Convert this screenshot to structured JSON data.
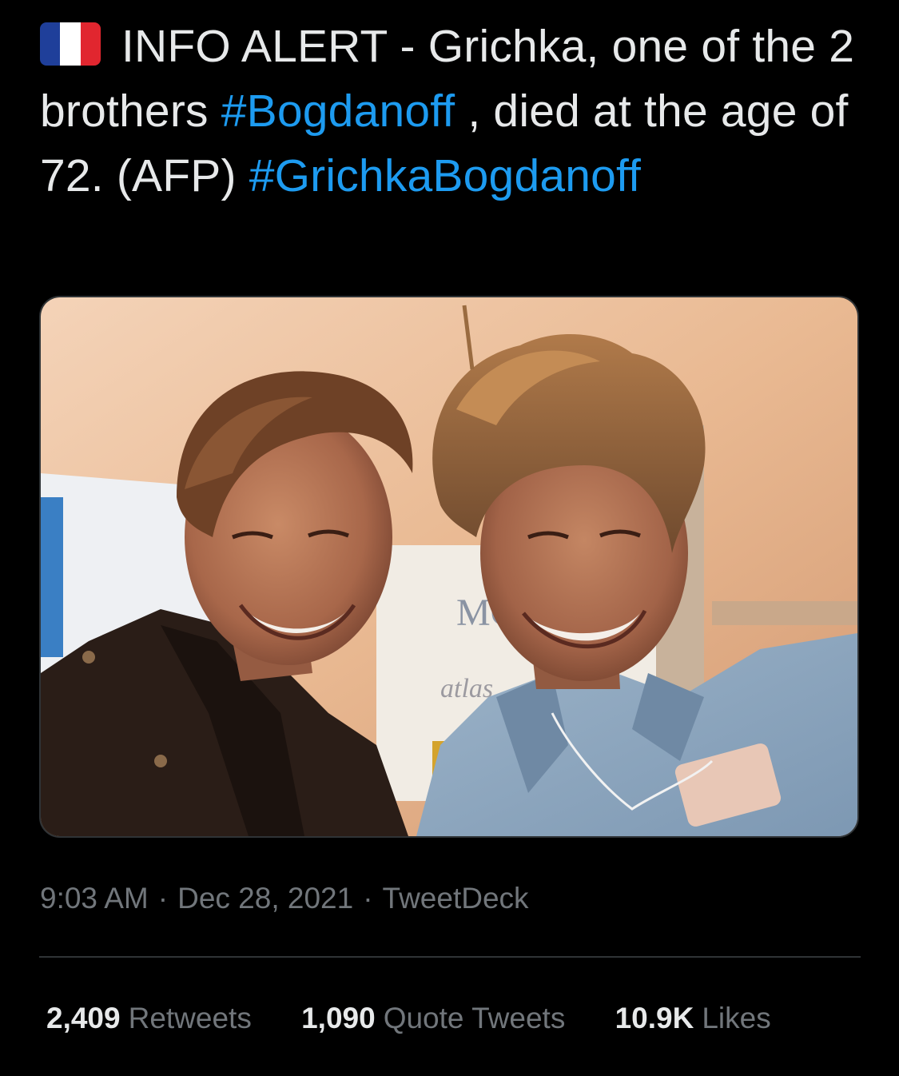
{
  "tweet": {
    "flag_icon": "france-flag-icon",
    "flag_colors": [
      "#1f3f9a",
      "#ffffff",
      "#e1262f"
    ],
    "text_part1": "INFO ALERT - Grichka, one of the 2 brothers ",
    "hashtag1": "#Bogdanoff",
    "text_part2": " , died at the age of 72. (AFP) ",
    "hashtag2": "#GrichkaBogdanoff",
    "link_color": "#1d9bf0"
  },
  "media": {
    "sign_text_1": "MC",
    "sign_text_2": "atlas"
  },
  "meta": {
    "time": "9:03 AM",
    "separator": "·",
    "date": "Dec 28, 2021",
    "source": "TweetDeck"
  },
  "stats": {
    "retweets_count": "2,409",
    "retweets_label": "Retweets",
    "quotes_count": "1,090",
    "quotes_label": "Quote Tweets",
    "likes_count": "10.9K",
    "likes_label": "Likes"
  }
}
